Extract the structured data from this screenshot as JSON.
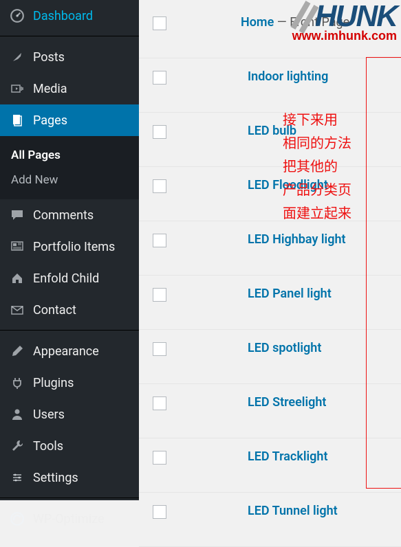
{
  "sidebar": {
    "items": [
      {
        "label": "Dashboard",
        "icon": "dashboard-icon"
      },
      {
        "label": "Posts",
        "icon": "pin-icon"
      },
      {
        "label": "Media",
        "icon": "media-icon"
      },
      {
        "label": "Pages",
        "icon": "pages-icon",
        "current": true,
        "submenu": [
          {
            "label": "All Pages",
            "current": true
          },
          {
            "label": "Add New"
          }
        ]
      },
      {
        "label": "Comments",
        "icon": "comment-icon"
      },
      {
        "label": "Portfolio Items",
        "icon": "portfolio-icon"
      },
      {
        "label": "Enfold Child",
        "icon": "home-icon"
      },
      {
        "label": "Contact",
        "icon": "mail-icon"
      },
      {
        "label": "Appearance",
        "icon": "brush-icon"
      },
      {
        "label": "Plugins",
        "icon": "plug-icon"
      },
      {
        "label": "Users",
        "icon": "user-icon"
      },
      {
        "label": "Tools",
        "icon": "wrench-icon"
      },
      {
        "label": "Settings",
        "icon": "settings-icon"
      },
      {
        "label": "WP-Optimize",
        "icon": "optimize-icon"
      }
    ]
  },
  "main": {
    "home_row": {
      "title": "Home",
      "suffix": " — Front Page"
    },
    "pages": [
      "Indoor lighting",
      "LED bulb",
      "LED Floodlight",
      "LED Highbay light",
      "LED Panel light",
      "LED spotlight",
      "LED Streelight",
      "LED Tracklight",
      "LED Tunnel light"
    ]
  },
  "annotation": {
    "lines": [
      "接下来用",
      "相同的方法",
      "把其他的",
      "产品分类页",
      "面建立起来"
    ]
  },
  "watermark": {
    "logo_text": "HUNK",
    "url": "www.imhunk.com"
  }
}
